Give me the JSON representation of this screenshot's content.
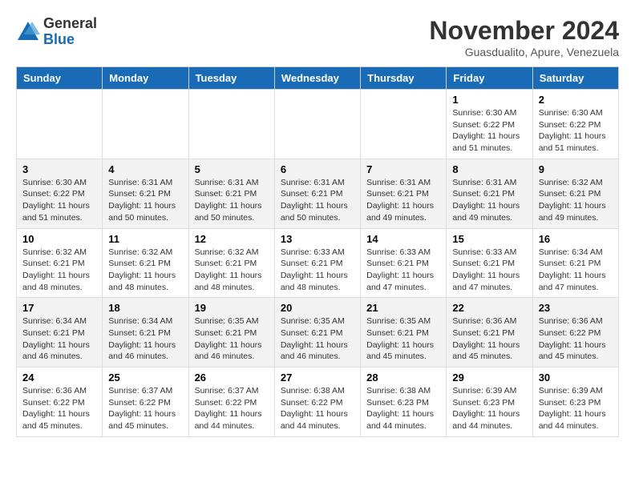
{
  "logo": {
    "general": "General",
    "blue": "Blue"
  },
  "title": "November 2024",
  "location": "Guasdualito, Apure, Venezuela",
  "days_of_week": [
    "Sunday",
    "Monday",
    "Tuesday",
    "Wednesday",
    "Thursday",
    "Friday",
    "Saturday"
  ],
  "weeks": [
    [
      {
        "day": "",
        "info": ""
      },
      {
        "day": "",
        "info": ""
      },
      {
        "day": "",
        "info": ""
      },
      {
        "day": "",
        "info": ""
      },
      {
        "day": "",
        "info": ""
      },
      {
        "day": "1",
        "info": "Sunrise: 6:30 AM\nSunset: 6:22 PM\nDaylight: 11 hours and 51 minutes."
      },
      {
        "day": "2",
        "info": "Sunrise: 6:30 AM\nSunset: 6:22 PM\nDaylight: 11 hours and 51 minutes."
      }
    ],
    [
      {
        "day": "3",
        "info": "Sunrise: 6:30 AM\nSunset: 6:22 PM\nDaylight: 11 hours and 51 minutes."
      },
      {
        "day": "4",
        "info": "Sunrise: 6:31 AM\nSunset: 6:21 PM\nDaylight: 11 hours and 50 minutes."
      },
      {
        "day": "5",
        "info": "Sunrise: 6:31 AM\nSunset: 6:21 PM\nDaylight: 11 hours and 50 minutes."
      },
      {
        "day": "6",
        "info": "Sunrise: 6:31 AM\nSunset: 6:21 PM\nDaylight: 11 hours and 50 minutes."
      },
      {
        "day": "7",
        "info": "Sunrise: 6:31 AM\nSunset: 6:21 PM\nDaylight: 11 hours and 49 minutes."
      },
      {
        "day": "8",
        "info": "Sunrise: 6:31 AM\nSunset: 6:21 PM\nDaylight: 11 hours and 49 minutes."
      },
      {
        "day": "9",
        "info": "Sunrise: 6:32 AM\nSunset: 6:21 PM\nDaylight: 11 hours and 49 minutes."
      }
    ],
    [
      {
        "day": "10",
        "info": "Sunrise: 6:32 AM\nSunset: 6:21 PM\nDaylight: 11 hours and 48 minutes."
      },
      {
        "day": "11",
        "info": "Sunrise: 6:32 AM\nSunset: 6:21 PM\nDaylight: 11 hours and 48 minutes."
      },
      {
        "day": "12",
        "info": "Sunrise: 6:32 AM\nSunset: 6:21 PM\nDaylight: 11 hours and 48 minutes."
      },
      {
        "day": "13",
        "info": "Sunrise: 6:33 AM\nSunset: 6:21 PM\nDaylight: 11 hours and 48 minutes."
      },
      {
        "day": "14",
        "info": "Sunrise: 6:33 AM\nSunset: 6:21 PM\nDaylight: 11 hours and 47 minutes."
      },
      {
        "day": "15",
        "info": "Sunrise: 6:33 AM\nSunset: 6:21 PM\nDaylight: 11 hours and 47 minutes."
      },
      {
        "day": "16",
        "info": "Sunrise: 6:34 AM\nSunset: 6:21 PM\nDaylight: 11 hours and 47 minutes."
      }
    ],
    [
      {
        "day": "17",
        "info": "Sunrise: 6:34 AM\nSunset: 6:21 PM\nDaylight: 11 hours and 46 minutes."
      },
      {
        "day": "18",
        "info": "Sunrise: 6:34 AM\nSunset: 6:21 PM\nDaylight: 11 hours and 46 minutes."
      },
      {
        "day": "19",
        "info": "Sunrise: 6:35 AM\nSunset: 6:21 PM\nDaylight: 11 hours and 46 minutes."
      },
      {
        "day": "20",
        "info": "Sunrise: 6:35 AM\nSunset: 6:21 PM\nDaylight: 11 hours and 46 minutes."
      },
      {
        "day": "21",
        "info": "Sunrise: 6:35 AM\nSunset: 6:21 PM\nDaylight: 11 hours and 45 minutes."
      },
      {
        "day": "22",
        "info": "Sunrise: 6:36 AM\nSunset: 6:21 PM\nDaylight: 11 hours and 45 minutes."
      },
      {
        "day": "23",
        "info": "Sunrise: 6:36 AM\nSunset: 6:22 PM\nDaylight: 11 hours and 45 minutes."
      }
    ],
    [
      {
        "day": "24",
        "info": "Sunrise: 6:36 AM\nSunset: 6:22 PM\nDaylight: 11 hours and 45 minutes."
      },
      {
        "day": "25",
        "info": "Sunrise: 6:37 AM\nSunset: 6:22 PM\nDaylight: 11 hours and 45 minutes."
      },
      {
        "day": "26",
        "info": "Sunrise: 6:37 AM\nSunset: 6:22 PM\nDaylight: 11 hours and 44 minutes."
      },
      {
        "day": "27",
        "info": "Sunrise: 6:38 AM\nSunset: 6:22 PM\nDaylight: 11 hours and 44 minutes."
      },
      {
        "day": "28",
        "info": "Sunrise: 6:38 AM\nSunset: 6:23 PM\nDaylight: 11 hours and 44 minutes."
      },
      {
        "day": "29",
        "info": "Sunrise: 6:39 AM\nSunset: 6:23 PM\nDaylight: 11 hours and 44 minutes."
      },
      {
        "day": "30",
        "info": "Sunrise: 6:39 AM\nSunset: 6:23 PM\nDaylight: 11 hours and 44 minutes."
      }
    ]
  ]
}
